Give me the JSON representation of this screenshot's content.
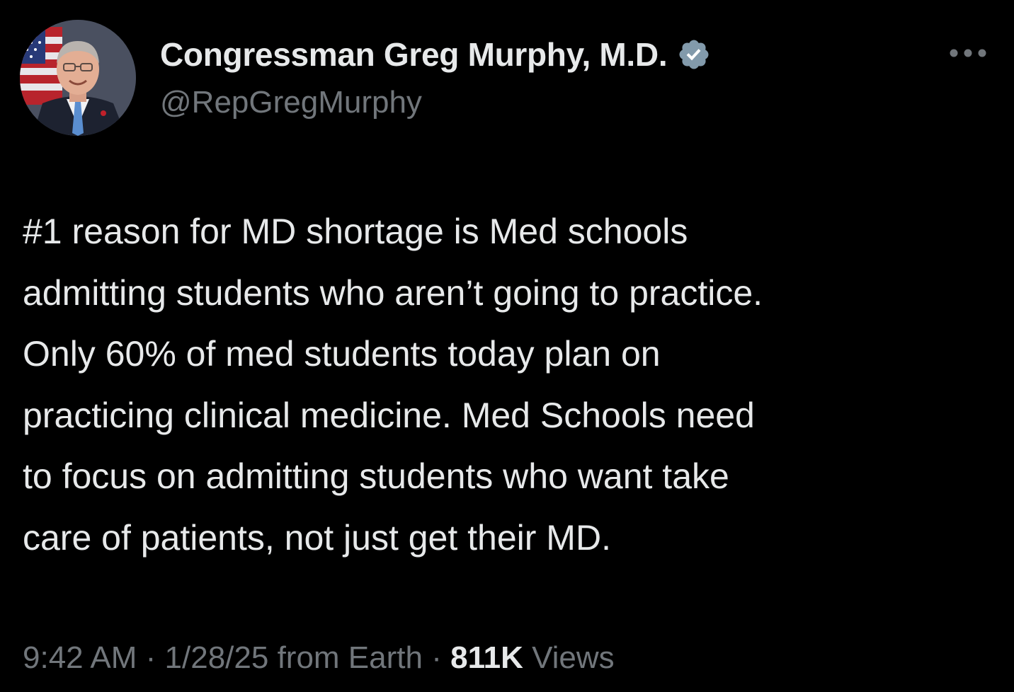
{
  "author": {
    "display_name": "Congressman Greg Murphy, M.D.",
    "handle": "@RepGregMurphy",
    "verified_icon": "verified-badge-icon",
    "avatar_icon": "profile-photo"
  },
  "menu": {
    "icon": "more-options-icon"
  },
  "tweet": {
    "lines": [
      "#1 reason for MD shortage is Med schools",
      "admitting students who aren’t going to practice.",
      "Only 60% of med students today plan on",
      "practicing clinical medicine. Med Schools need",
      "to focus on admitting students who want take",
      "care of patients, not just get their MD."
    ]
  },
  "meta": {
    "time": "9:42 AM",
    "separator": " · ",
    "date": "1/28/25",
    "source": " from Earth",
    "views_count": "811K",
    "views_label": " Views"
  },
  "colors": {
    "background": "#000000",
    "primary_text": "#e7e9ea",
    "secondary_text": "#71767b",
    "verified_badge": "#829aab"
  }
}
